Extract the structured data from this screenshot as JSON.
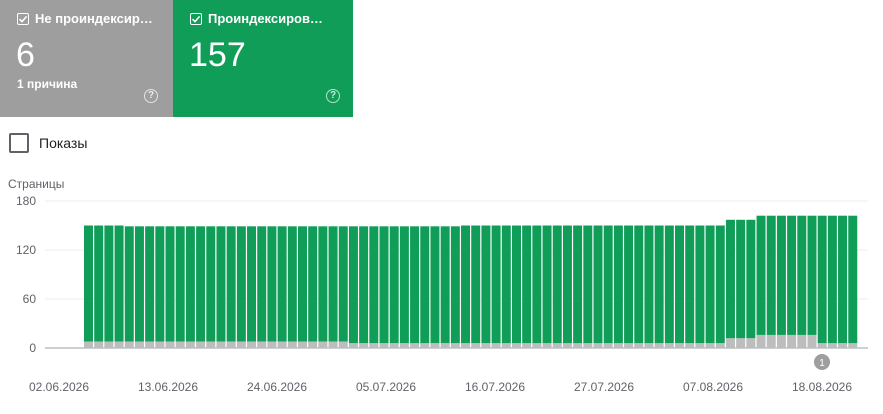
{
  "cards": {
    "not_indexed": {
      "label": "Не проиндексир…",
      "value": "6",
      "sub": "1 причина",
      "checked": true
    },
    "indexed": {
      "label": "Проиндексирова…",
      "value": "157",
      "checked": true
    }
  },
  "impressions": {
    "label": "Показы",
    "checked": false
  },
  "colors": {
    "indexed": "#0f9d58",
    "not_indexed": "#bdbdbd",
    "gray_card": "#9e9e9e"
  },
  "annotation": {
    "label": "1"
  },
  "chart_data": {
    "type": "bar",
    "stacked": true,
    "ylabel": "Страницы",
    "ylim": [
      0,
      180
    ],
    "yticks": [
      "180",
      "120",
      "60",
      "0"
    ],
    "grid": true,
    "xtick_labels": [
      "02.06.2026",
      "13.06.2026",
      "24.06.2026",
      "05.07.2026",
      "16.07.2026",
      "27.07.2026",
      "07.08.2026",
      "18.08.2026"
    ],
    "start": "2026-06-02",
    "series": [
      {
        "name": "Не проиндексир…",
        "color": "#bdbdbd",
        "values": [
          8,
          8,
          8,
          8,
          8,
          8,
          8,
          8,
          8,
          8,
          8,
          8,
          8,
          8,
          8,
          8,
          8,
          8,
          8,
          8,
          8,
          8,
          8,
          8,
          8,
          8,
          6,
          6,
          6,
          6,
          6,
          6,
          6,
          6,
          6,
          6,
          6,
          6,
          6,
          6,
          6,
          6,
          6,
          6,
          6,
          6,
          6,
          6,
          6,
          6,
          6,
          6,
          6,
          6,
          6,
          6,
          6,
          6,
          6,
          6,
          6,
          6,
          6,
          12,
          12,
          12,
          16,
          16,
          16,
          16,
          16,
          16,
          6,
          6,
          6,
          6
        ]
      },
      {
        "name": "Проиндексирова…",
        "color": "#0f9d58",
        "values": [
          142,
          142,
          142,
          142,
          141,
          141,
          141,
          141,
          141,
          141,
          141,
          141,
          141,
          141,
          141,
          141,
          141,
          141,
          141,
          141,
          141,
          141,
          141,
          141,
          141,
          141,
          143,
          143,
          143,
          143,
          143,
          143,
          143,
          143,
          143,
          143,
          143,
          144,
          144,
          144,
          144,
          144,
          144,
          144,
          144,
          144,
          144,
          144,
          144,
          144,
          144,
          144,
          144,
          144,
          144,
          144,
          144,
          144,
          144,
          144,
          144,
          144,
          144,
          145,
          145,
          145,
          146,
          146,
          146,
          146,
          146,
          146,
          156,
          156,
          156,
          156
        ]
      }
    ]
  }
}
